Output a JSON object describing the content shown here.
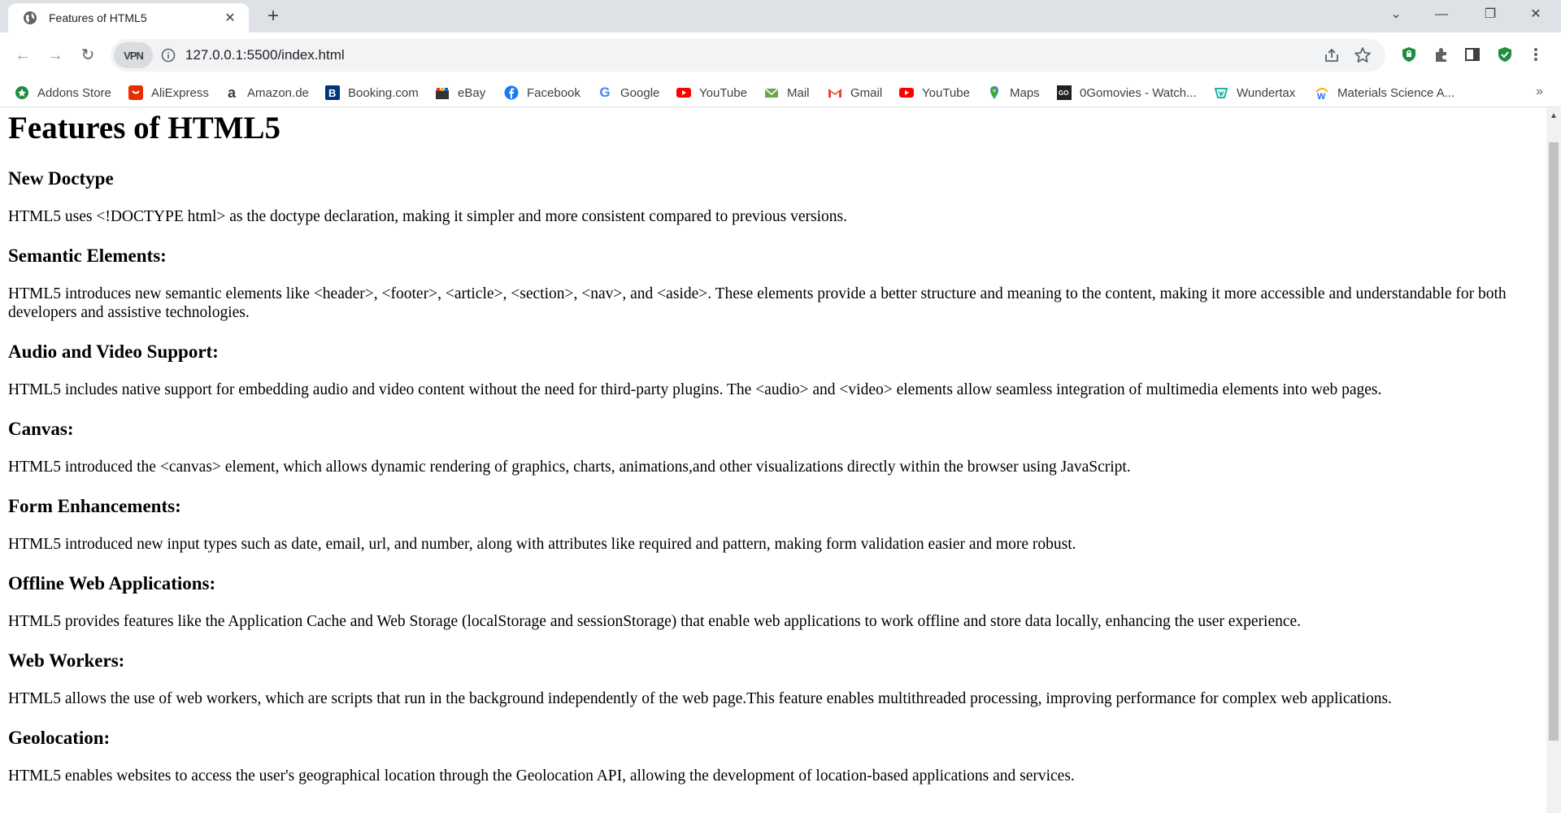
{
  "browser": {
    "tab_title": "Features of HTML5",
    "tab_close": "✕",
    "new_tab": "+",
    "url": "127.0.0.1:5500/index.html",
    "vpn_label": "VPN",
    "window_controls": {
      "dropdown": "⌄",
      "minimize": "—",
      "restore": "❐",
      "close": "✕"
    },
    "nav": {
      "back": "←",
      "forward": "→",
      "reload": "↻"
    }
  },
  "bookmarks": [
    {
      "label": "Addons Store",
      "icon": "addons-store-icon",
      "color": "#1e8e3e"
    },
    {
      "label": "AliExpress",
      "icon": "aliexpress-icon",
      "color": "#e62e04"
    },
    {
      "label": "Amazon.de",
      "icon": "amazon-icon",
      "color": "#000000"
    },
    {
      "label": "Booking.com",
      "icon": "booking-icon",
      "color": "#003580"
    },
    {
      "label": "eBay",
      "icon": "ebay-icon",
      "color": "#e53238"
    },
    {
      "label": "Facebook",
      "icon": "facebook-icon",
      "color": "#1877f2"
    },
    {
      "label": "Google",
      "icon": "google-icon",
      "color": "#4285f4"
    },
    {
      "label": "YouTube",
      "icon": "youtube-icon",
      "color": "#ff0000"
    },
    {
      "label": "Mail",
      "icon": "mail-icon",
      "color": "#6aa84f"
    },
    {
      "label": "Gmail",
      "icon": "gmail-icon",
      "color": "#ea4335"
    },
    {
      "label": "YouTube",
      "icon": "youtube-icon",
      "color": "#ff0000"
    },
    {
      "label": "Maps",
      "icon": "maps-icon",
      "color": "#34a853"
    },
    {
      "label": "0Gomovies - Watch...",
      "icon": "gomovies-icon",
      "color": "#222222"
    },
    {
      "label": "Wundertax",
      "icon": "wundertax-icon",
      "color": "#19b5a5"
    },
    {
      "label": "Materials Science A...",
      "icon": "materials-science-icon",
      "color": "#f4b400"
    }
  ],
  "bookmarks_more": "»",
  "page": {
    "title": "Features of HTML5",
    "sections": [
      {
        "heading": "New Doctype",
        "text": "HTML5 uses <!DOCTYPE html> as the doctype declaration, making it simpler and more consistent compared to previous versions."
      },
      {
        "heading": "Semantic Elements:",
        "text": "HTML5 introduces new semantic elements like <header>, <footer>, <article>, <section>, <nav>, and <aside>. These elements provide a better structure and meaning to the content, making it more accessible and understandable for both developers and assistive technologies."
      },
      {
        "heading": "Audio and Video Support:",
        "text": "HTML5 includes native support for embedding audio and video content without the need for third-party plugins. The <audio> and <video> elements allow seamless integration of multimedia elements into web pages."
      },
      {
        "heading": "Canvas:",
        "text": "HTML5 introduced the <canvas> element, which allows dynamic rendering of graphics, charts, animations,and other visualizations directly within the browser using JavaScript."
      },
      {
        "heading": "Form Enhancements:",
        "text": "HTML5 introduced new input types such as date, email, url, and number, along with attributes like required and pattern, making form validation easier and more robust."
      },
      {
        "heading": "Offline Web Applications:",
        "text": "HTML5 provides features like the Application Cache and Web Storage (localStorage and sessionStorage) that enable web applications to work offline and store data locally, enhancing the user experience."
      },
      {
        "heading": "Web Workers:",
        "text": "HTML5 allows the use of web workers, which are scripts that run in the background independently of the web page.This feature enables multithreaded processing, improving performance for complex web applications."
      },
      {
        "heading": "Geolocation:",
        "text": "HTML5 enables websites to access the user's geographical location through the Geolocation API, allowing the development of location-based applications and services."
      }
    ]
  }
}
